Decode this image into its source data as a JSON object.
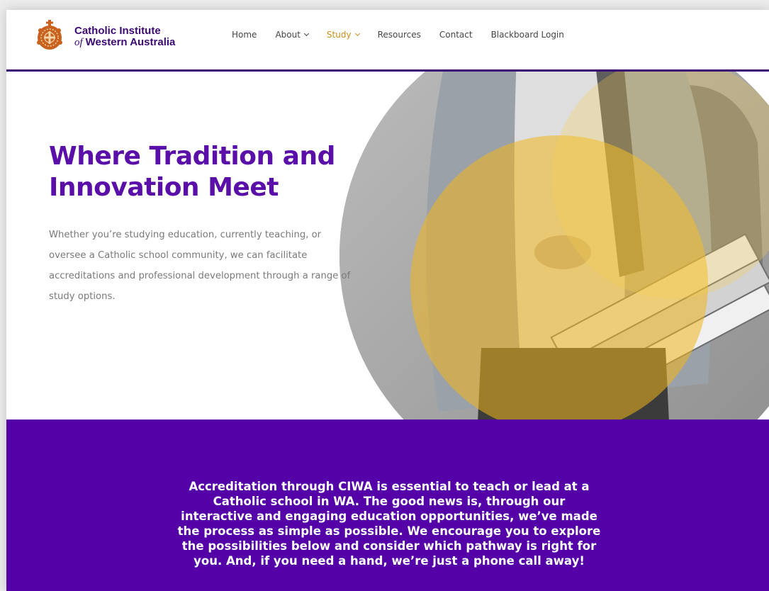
{
  "brand": {
    "line1": "Catholic Institute",
    "line2_of": "of",
    "line2_rest": "Western Australia",
    "primary_color": "#3c0a73",
    "logo_color": "#c9621f"
  },
  "nav": {
    "items": [
      {
        "label": "Home",
        "has_dropdown": false,
        "active": false
      },
      {
        "label": "About",
        "has_dropdown": true,
        "active": false
      },
      {
        "label": "Study",
        "has_dropdown": true,
        "active": true
      },
      {
        "label": "Resources",
        "has_dropdown": false,
        "active": false
      },
      {
        "label": "Contact",
        "has_dropdown": false,
        "active": false
      },
      {
        "label": "Blackboard Login",
        "has_dropdown": false,
        "active": false
      }
    ],
    "active_color": "#c9911c"
  },
  "hero": {
    "title": "Where Tradition and Innovation Meet",
    "text": "Whether you’re studying education, currently teaching, or oversee a Catholic school community, we can facilitate accreditations and professional development through a range of study options.",
    "title_color": "#5a0fa8"
  },
  "band": {
    "text": "Accreditation through CIWA is essential to teach or lead at a Catholic school in WA. The good news is, through our interactive and engaging education opportunities, we’ve made the process as simple as possible. We encourage you to explore the possibilities below and consider which pathway is right for you. And, if you need a hand, we’re just a phone call away!",
    "background_color": "#5402a8"
  }
}
